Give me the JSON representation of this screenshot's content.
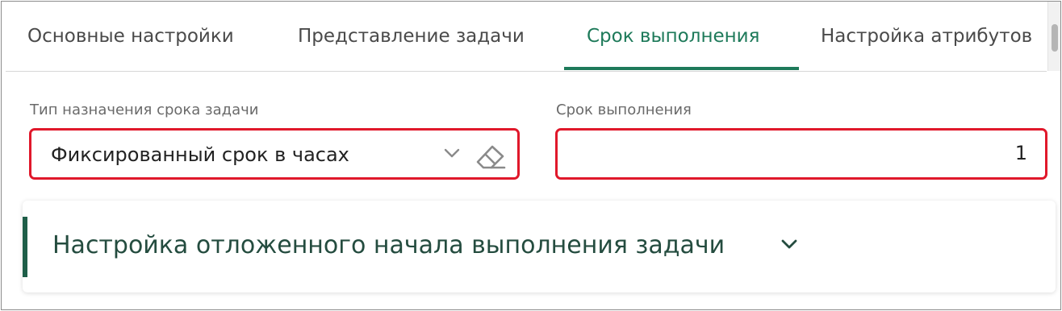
{
  "tabs": [
    {
      "label": "Основные настройки",
      "active": false
    },
    {
      "label": "Представление задачи",
      "active": false
    },
    {
      "label": "Срок выполнения",
      "active": true
    },
    {
      "label": "Настройка атрибутов",
      "active": false
    }
  ],
  "deadline_type": {
    "label": "Тип назначения срока задачи",
    "value": "Фиксированный срок в часах",
    "icons": [
      "chevron-down-icon",
      "eraser-icon"
    ]
  },
  "deadline": {
    "label": "Срок выполнения",
    "value": "1"
  },
  "deferred_start_section": {
    "title": "Настройка отложенного начала выполнения задачи",
    "expanded": false,
    "icon": "chevron-down-icon"
  },
  "colors": {
    "accent": "#1e7a5a",
    "highlight_border": "#e0182b",
    "section_title": "#244c3f"
  }
}
